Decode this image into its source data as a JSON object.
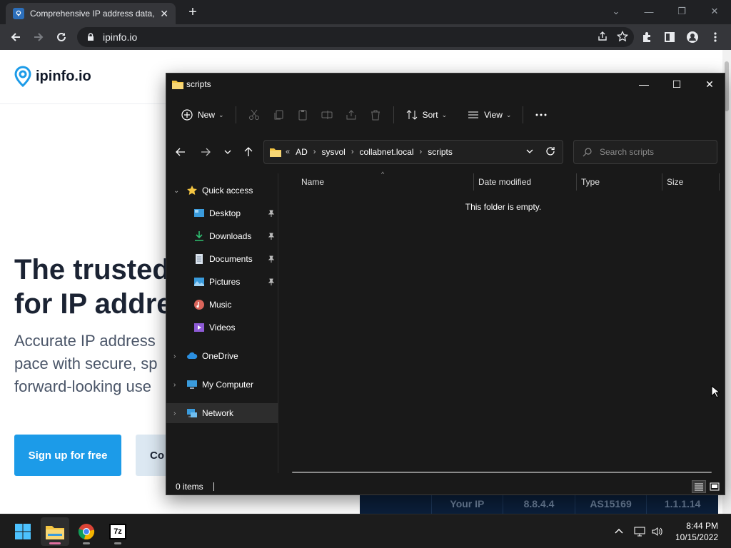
{
  "browser": {
    "tab_title": "Comprehensive IP address data, IP",
    "new_tab_symbol": "+",
    "url": "ipinfo.io"
  },
  "webpage": {
    "brand": "ipinfo.io",
    "hero_title_line1": "The trusted",
    "hero_title_line2": "for IP addre",
    "hero_sub_line1": "Accurate IP address",
    "hero_sub_line2": "pace with secure, sp",
    "hero_sub_line3": "forward-looking use",
    "signup_label": "Sign up for free",
    "contact_label": "Co",
    "ip_strip": [
      "",
      "Your IP",
      "8.8.4.4",
      "AS15169",
      "1.1.1.14"
    ]
  },
  "explorer": {
    "title": "scripts",
    "commands": {
      "new_label": "New",
      "sort_label": "Sort",
      "view_label": "View"
    },
    "breadcrumb": [
      "AD",
      "sysvol",
      "collabnet.local",
      "scripts"
    ],
    "breadcrumb_overflow": "«",
    "search_placeholder": "Search scripts",
    "nav": {
      "quick_access": "Quick access",
      "desktop": "Desktop",
      "downloads": "Downloads",
      "documents": "Documents",
      "pictures": "Pictures",
      "music": "Music",
      "videos": "Videos",
      "onedrive": "OneDrive",
      "my_computer": "My Computer",
      "network": "Network"
    },
    "columns": {
      "name": "Name",
      "date_modified": "Date modified",
      "type": "Type",
      "size": "Size"
    },
    "empty_message": "This folder is empty.",
    "status_text": "0 items"
  },
  "taskbar": {
    "apps": [
      "Start",
      "File Explorer",
      "Google Chrome",
      "7-Zip"
    ],
    "sevenzip_label": "7z",
    "time": "8:44 PM",
    "date": "10/15/2022"
  },
  "colors": {
    "chrome_dark": "#202124",
    "explorer_bg": "#191919",
    "accent_blue": "#1c9be8",
    "folder_yellow": "#f4c542"
  }
}
